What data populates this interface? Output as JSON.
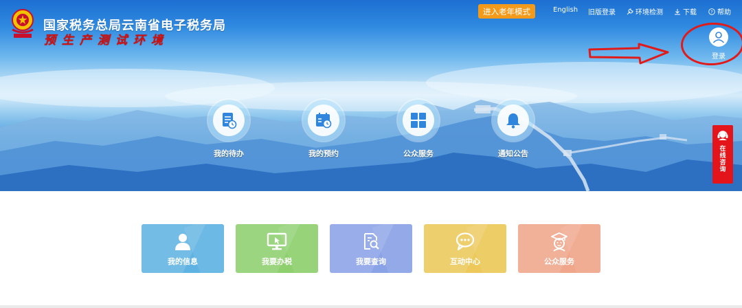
{
  "header": {
    "title": "国家税务总局云南省电子税务局",
    "env_stamp": "预生产测试环境",
    "elder_mode": "进入老年模式",
    "links": {
      "english": "English",
      "old_login": "旧版登录",
      "env_check": "环境检测",
      "download": "下载",
      "help": "帮助"
    },
    "login": "登录"
  },
  "services": [
    {
      "label": "我的待办",
      "icon": "document-clock-icon"
    },
    {
      "label": "我的预约",
      "icon": "calendar-clock-icon"
    },
    {
      "label": "公众服务",
      "icon": "grid-icon"
    },
    {
      "label": "通知公告",
      "icon": "bell-icon"
    }
  ],
  "consult": {
    "label": "在线咨询",
    "icon": "headset-icon"
  },
  "tiles": [
    {
      "label": "我的信息",
      "icon": "user-icon",
      "color": "#5fb3e2"
    },
    {
      "label": "我要办税",
      "icon": "monitor-cursor-icon",
      "color": "#8ed06e"
    },
    {
      "label": "我要查询",
      "icon": "document-search-icon",
      "color": "#8aa2e6"
    },
    {
      "label": "互动中心",
      "icon": "chat-bubble-icon",
      "color": "#ecc95a"
    },
    {
      "label": "公众服务",
      "icon": "student-icon",
      "color": "#f0a68a"
    }
  ],
  "colors": {
    "elder_button": "#f39a1a",
    "consult_red": "#e4141b",
    "annotation_red": "#e11a1a"
  }
}
